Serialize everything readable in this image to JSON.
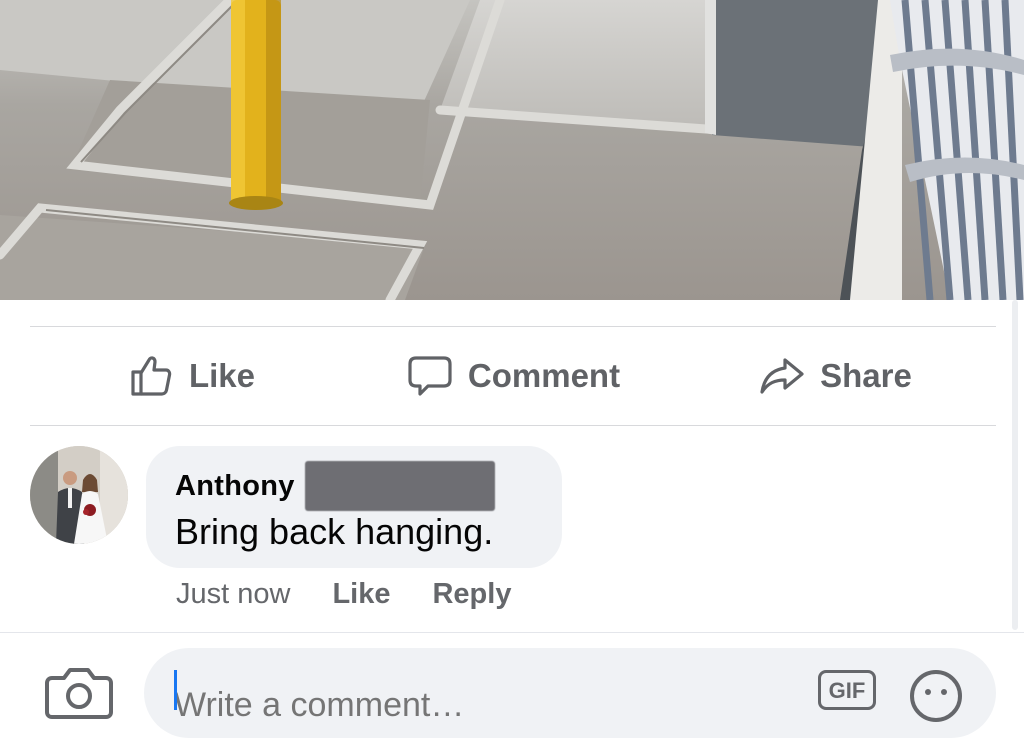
{
  "post": {
    "photo_icon": "post-photo"
  },
  "actions": {
    "like_label": "Like",
    "comment_label": "Comment",
    "share_label": "Share"
  },
  "comment": {
    "author": "Anthony",
    "text": "Bring back hanging.",
    "time": "Just now",
    "like_label": "Like",
    "reply_label": "Reply"
  },
  "composer": {
    "placeholder": "Write a comment…",
    "visible_placeholder": "Write a comment",
    "gif_label": "GIF"
  },
  "colors": {
    "action_text": "#606266",
    "meta_text": "#65676b",
    "bubble_bg": "#f0f2f5",
    "caret": "#1877f2"
  }
}
